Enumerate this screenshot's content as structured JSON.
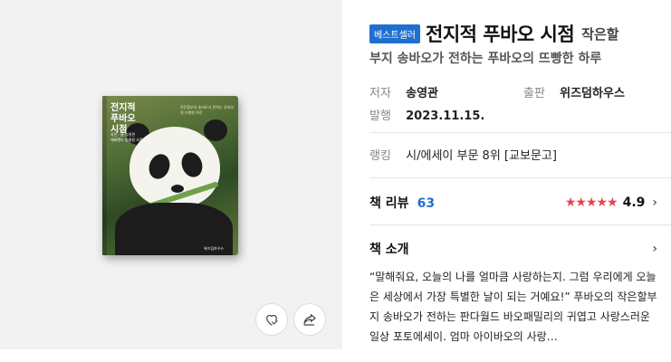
{
  "cover": {
    "title": "전지적\n푸바오\n시점",
    "tagline": "작은할부지 송바오가 전하는 푸바오의 뜨빵한 하루",
    "author": "사진ㆍ글 송영관\n에버랜드 동물원 사육사",
    "publisher": "위즈덤하우스"
  },
  "actions": {
    "like_icon": "heart-check-icon",
    "share_icon": "share-icon"
  },
  "book": {
    "badge": "베스트셀러",
    "title": "전지적 푸바오 시점",
    "title_suffix": "작은할",
    "subtitle": "부지 송바오가 전하는 푸바오의 뜨빵한 하루",
    "author_label": "저자",
    "author": "송영관",
    "publisher_label": "출판",
    "publisher": "위즈덤하우스",
    "date_label": "발행",
    "date": "2023.11.15.",
    "ranking_label": "랭킹",
    "ranking": "시/에세이 부문 8위 [교보문고]"
  },
  "review": {
    "label": "책 리뷰",
    "count": "63",
    "stars": "★★★★★",
    "score": "4.9",
    "chevron": "›"
  },
  "intro": {
    "label": "책 소개",
    "chevron": "›",
    "text": "“말해줘요, 오늘의 나를 얼마큼 사랑하는지. 그럼 우리에게 오늘은 세상에서 가장 특별한 날이 되는 거예요!” 푸바오의 작은할부지 송바오가 전하는 판다월드 바오패밀리의 귀엽고 사랑스러운 일상 포토에세이. 엄마 아이바오의 사랑…"
  },
  "colors": {
    "accent": "#1f6fd1",
    "star": "#e8434f",
    "left_bg": "#f2f2f2"
  }
}
